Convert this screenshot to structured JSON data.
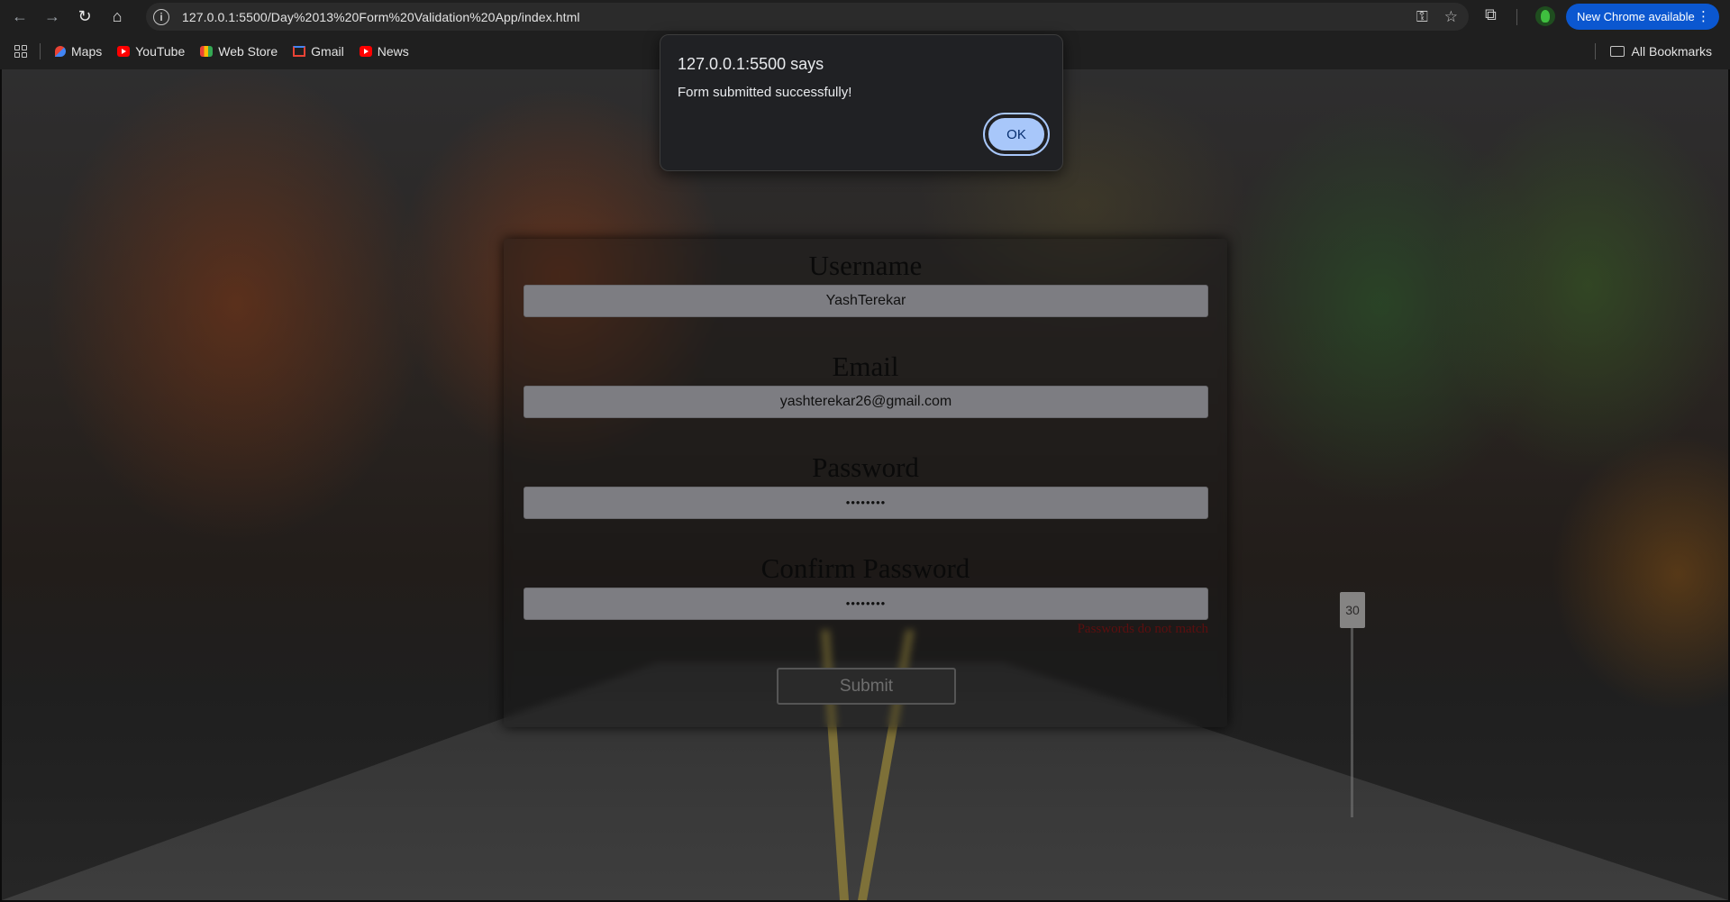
{
  "browser": {
    "url": "127.0.0.1:5500/Day%2013%20Form%20Validation%20App/index.html",
    "update_label": "New Chrome available",
    "bookmarks": [
      {
        "label": "Maps",
        "icon": "maps-icon"
      },
      {
        "label": "YouTube",
        "icon": "youtube-icon"
      },
      {
        "label": "Web Store",
        "icon": "webstore-icon"
      },
      {
        "label": "Gmail",
        "icon": "gmail-icon"
      },
      {
        "label": "News",
        "icon": "youtube-icon"
      }
    ],
    "all_bookmarks_label": "All Bookmarks"
  },
  "form": {
    "username": {
      "label": "Username",
      "value": "YashTerekar"
    },
    "email": {
      "label": "Email",
      "value": "yashterekar26@gmail.com"
    },
    "password": {
      "label": "Password",
      "value": "••••••••"
    },
    "confirm_password": {
      "label": "Confirm Password",
      "value": "••••••••",
      "error": "Passwords do not match"
    },
    "submit_label": "Submit"
  },
  "alert": {
    "title": "127.0.0.1:5500 says",
    "message": "Form submitted successfully!",
    "ok_label": "OK"
  },
  "background": {
    "sign_text": "30"
  },
  "colors": {
    "accent_blue": "#0b57d0",
    "dialog_ok": "#a8c7fa",
    "error_red": "#5c0f0f"
  }
}
